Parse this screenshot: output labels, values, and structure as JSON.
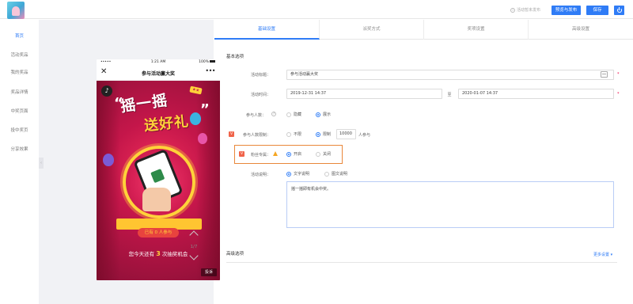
{
  "header": {
    "status_text": "活动暂未发布",
    "preview_publish_label": "预览与发布",
    "save_label": "保存"
  },
  "sidebar": {
    "items": [
      {
        "label": "首页"
      },
      {
        "label": "活动奖品"
      },
      {
        "label": "我的奖品"
      },
      {
        "label": "奖品详情"
      },
      {
        "label": "中奖页面"
      },
      {
        "label": "投中奖页"
      },
      {
        "label": "分享效果"
      }
    ]
  },
  "phone": {
    "status_dots": "•••••",
    "time": "1:21 AM",
    "battery": "100%",
    "close": "✕",
    "title": "参与活动赢大奖",
    "more": "•••",
    "headline1": "摇一摇",
    "headline2": "送好礼",
    "pill_text": "已有 0 人参与",
    "bottom_prefix": "您今天还有",
    "bottom_number": "3",
    "bottom_suffix": "次抽奖机会",
    "report_label": "投诉",
    "page_indicator": "1/7"
  },
  "tabs": [
    {
      "label": "基础设置"
    },
    {
      "label": "派奖方式"
    },
    {
      "label": "奖项设置"
    },
    {
      "label": "高级设置"
    }
  ],
  "basic": {
    "section_title": "基本选项",
    "title_label": "活动标题：",
    "title_value": "参与活动赢大奖",
    "time_label": "活动时间：",
    "start_time": "2019-12-31 14:37",
    "to_label": "至",
    "end_time": "2020-01-07 14:37",
    "count_label": "参与人数：",
    "count_hide": "隐藏",
    "count_show": "展示",
    "limit_label": "参与人数限制：",
    "limit_none": "不限",
    "limit_on": "限制",
    "limit_value": "10000",
    "limit_unit": "人参与",
    "fans_label": "粉丝专属：",
    "fans_on": "开启",
    "fans_off": "关闭",
    "desc_label": "活动说明：",
    "desc_text_mode": "文字说明",
    "desc_image_mode": "图文说明",
    "desc_value": "摇一摇即有机会中奖。"
  },
  "advanced": {
    "section_title": "高级选项",
    "more_settings": "更多设置 ▾"
  },
  "colors": {
    "accent": "#2f7cf6",
    "highlight": "#e9873a",
    "banner": "#c4164a"
  }
}
